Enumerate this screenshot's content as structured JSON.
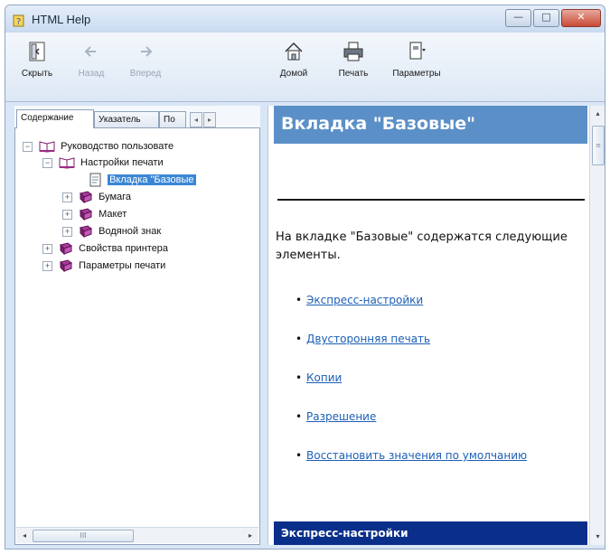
{
  "window": {
    "title": "HTML Help"
  },
  "titlebar_buttons": {
    "minimize_glyph": "—",
    "maximize_glyph": "□",
    "close_glyph": "✕"
  },
  "toolbar": {
    "items": [
      {
        "label": "Скрыть",
        "icon": "hide-pane-icon",
        "enabled": true
      },
      {
        "label": "Назад",
        "icon": "back-arrow-icon",
        "enabled": false
      },
      {
        "label": "Вперед",
        "icon": "forward-arrow-icon",
        "enabled": false
      },
      {
        "label": "Домой",
        "icon": "home-icon",
        "enabled": true
      },
      {
        "label": "Печать",
        "icon": "printer-icon",
        "enabled": true
      },
      {
        "label": "Параметры",
        "icon": "options-icon",
        "enabled": true
      }
    ]
  },
  "navigation": {
    "tabs": [
      "Содержание",
      "Указатель",
      "По"
    ],
    "tab_scroll_left": "◂",
    "tab_scroll_right": "▸",
    "tree": [
      {
        "label": "Руководство пользовате",
        "expander": "−",
        "icon": "open-book-icon"
      },
      {
        "label": "Настройки печати",
        "expander": "−",
        "icon": "open-book-icon"
      },
      {
        "label": "Вкладка \"Базовые",
        "expander": "",
        "icon": "page-icon",
        "selected": true
      },
      {
        "label": "Бумага",
        "expander": "+",
        "icon": "closed-book-icon"
      },
      {
        "label": "Макет",
        "expander": "+",
        "icon": "closed-book-icon"
      },
      {
        "label": "Водяной знак",
        "expander": "+",
        "icon": "closed-book-icon"
      },
      {
        "label": "Свойства принтера",
        "expander": "+",
        "icon": "closed-book-icon"
      },
      {
        "label": "Параметры печати",
        "expander": "+",
        "icon": "closed-book-icon"
      }
    ],
    "hscroll_left": "◂",
    "hscroll_right": "▸",
    "hscroll_thumb": "III"
  },
  "content": {
    "header_title": "Вкладка \"Базовые\"",
    "paragraph": "На вкладке \"Базовые\" содержатся следующие элементы.",
    "bullet": "•",
    "links": [
      "Экспресс-настройки",
      "Двусторонняя печать",
      "Копии",
      "Разрешение",
      "Восстановить значения по умолчанию"
    ],
    "footer_title": "Экспресс-настройки",
    "vscroll_up": "▴",
    "vscroll_down": "▾",
    "vscroll_thumb": "≡"
  },
  "colors": {
    "header_blue": "#5b8fc7",
    "footer_navy": "#0a2f8a",
    "link_blue": "#1c5fb6",
    "selection_blue": "#3a86d6"
  }
}
